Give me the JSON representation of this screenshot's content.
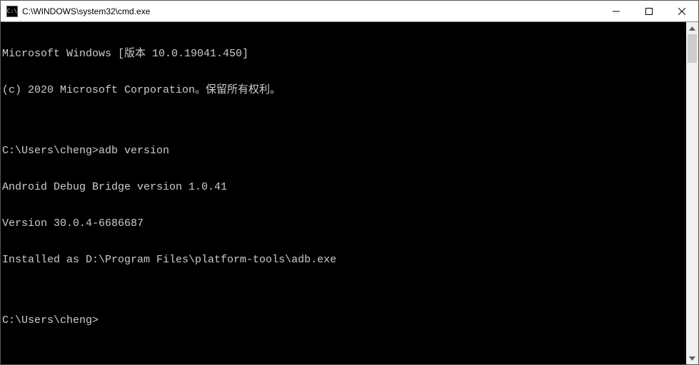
{
  "titlebar": {
    "icon_label": "C:\\",
    "title": "C:\\WINDOWS\\system32\\cmd.exe"
  },
  "terminal": {
    "banner1": "Microsoft Windows [版本 10.0.19041.450]",
    "banner2": "(c) 2020 Microsoft Corporation。保留所有权利。",
    "blank": "",
    "prompt1": "C:\\Users\\cheng>",
    "cmd1": "adb version",
    "out1": "Android Debug Bridge version 1.0.41",
    "out2": "Version 30.0.4-6686687",
    "out3": "Installed as D:\\Program Files\\platform-tools\\adb.exe",
    "prompt2": "C:\\Users\\cheng>"
  }
}
